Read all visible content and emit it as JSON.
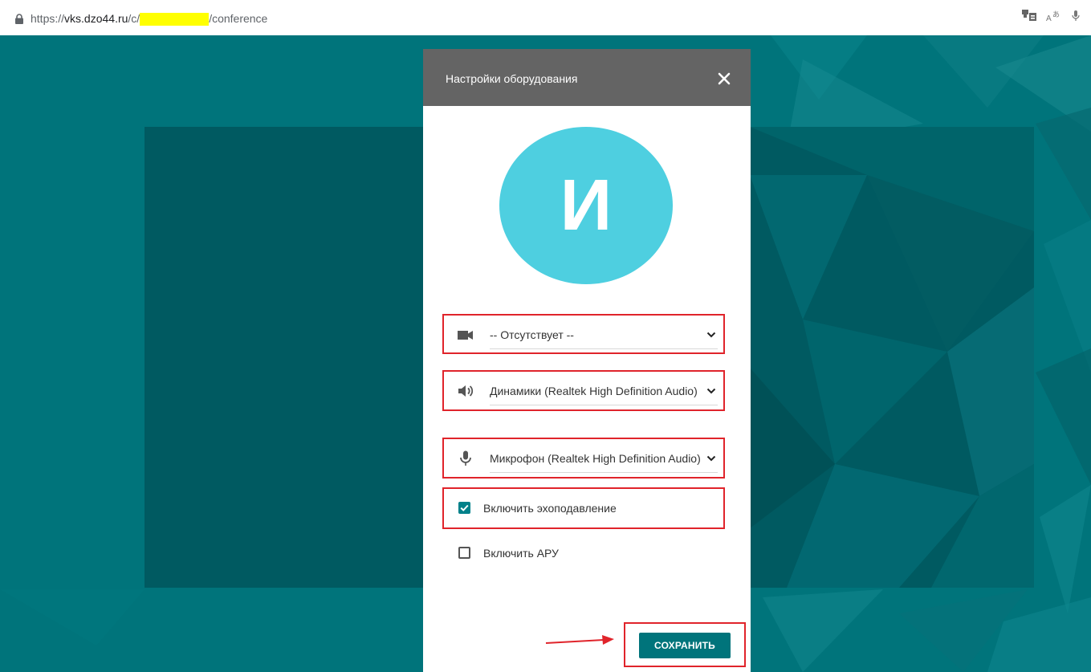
{
  "browser": {
    "url_prefix": "https://",
    "url_domain": "vks.dzo44.ru",
    "url_path_start": "/c/",
    "url_path_end": "/conference"
  },
  "modal": {
    "title": "Настройки оборудования",
    "avatar_letter": "И",
    "camera": {
      "icon": "video-camera-icon",
      "value": "-- Отсутствует --"
    },
    "speakers": {
      "icon": "speaker-icon",
      "value": "Динамики (Realtek High Definition Audio)"
    },
    "microphone": {
      "icon": "microphone-icon",
      "value": "Микрофон (Realtek High Definition Audio)"
    },
    "echo_cancel": {
      "label": "Включить эхоподавление",
      "checked": true
    },
    "agc": {
      "label": "Включить АРУ",
      "checked": false
    },
    "save_label": "СОХРАНИТЬ"
  },
  "colors": {
    "header_bg": "#646464",
    "accent": "#00747b",
    "avatar": "#4ecfe0",
    "annotation": "#e0242b",
    "url_highlight": "#ffff00"
  }
}
